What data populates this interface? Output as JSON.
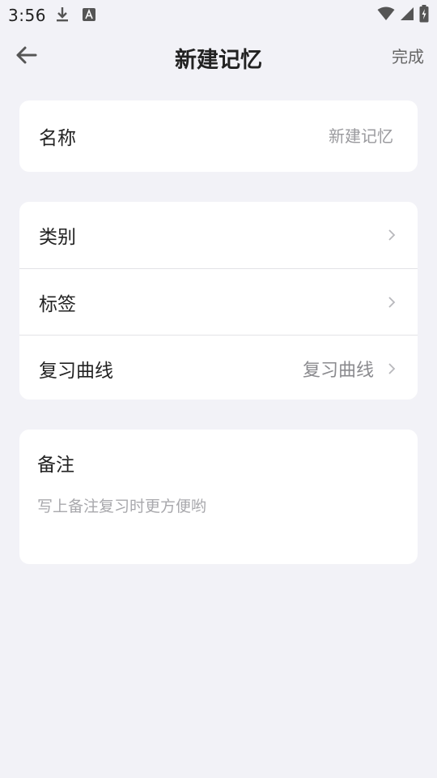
{
  "status_bar": {
    "time": "3:56",
    "icons": [
      "download-icon",
      "font-icon",
      "wifi-icon",
      "signal-icon",
      "battery-icon"
    ]
  },
  "nav": {
    "title": "新建记忆",
    "done_label": "完成",
    "back_icon": "arrow-left-icon"
  },
  "name_card": {
    "label": "名称",
    "placeholder": "新建记忆",
    "value": ""
  },
  "options": {
    "category": {
      "label": "类别",
      "value": ""
    },
    "tags": {
      "label": "标签",
      "value": ""
    },
    "curve": {
      "label": "复习曲线",
      "value": "复习曲线"
    }
  },
  "note": {
    "title": "备注",
    "placeholder": "写上备注复习时更方便哟",
    "value": ""
  },
  "colors": {
    "background": "#f2f2f7",
    "card": "#ffffff",
    "text_primary": "#222222",
    "text_secondary": "#8a8a8e",
    "divider": "#e3e3e6"
  }
}
